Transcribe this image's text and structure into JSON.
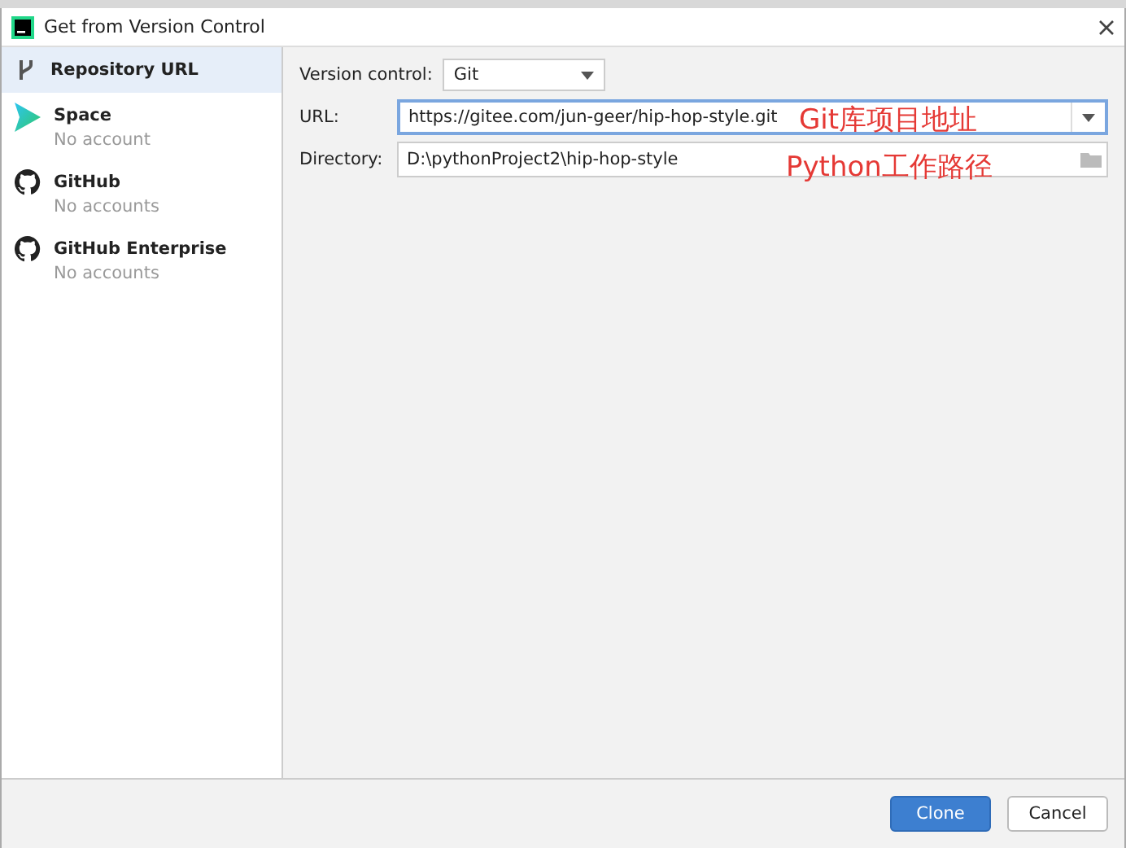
{
  "window": {
    "title": "Get from Version Control"
  },
  "sidebar": {
    "items": [
      {
        "kind": "repository",
        "label": "Repository URL",
        "selected": true
      },
      {
        "kind": "space",
        "label": "Space",
        "sublabel": "No account",
        "selected": false
      },
      {
        "kind": "github",
        "label": "GitHub",
        "sublabel": "No accounts",
        "selected": false
      },
      {
        "kind": "github",
        "label": "GitHub Enterprise",
        "sublabel": "No accounts",
        "selected": false
      }
    ]
  },
  "form": {
    "version_control": {
      "label": "Version control:",
      "value": "Git"
    },
    "url": {
      "label": "URL:",
      "value": "https://gitee.com/jun-geer/hip-hop-style.git",
      "annotation": "Git库项目地址"
    },
    "directory": {
      "label": "Directory:",
      "value": "D:\\pythonProject2\\hip-hop-style",
      "annotation": "Python工作路径"
    }
  },
  "buttons": [
    {
      "label": "Clone",
      "kind": "primary"
    },
    {
      "label": "Cancel",
      "kind": "secondary"
    }
  ]
}
